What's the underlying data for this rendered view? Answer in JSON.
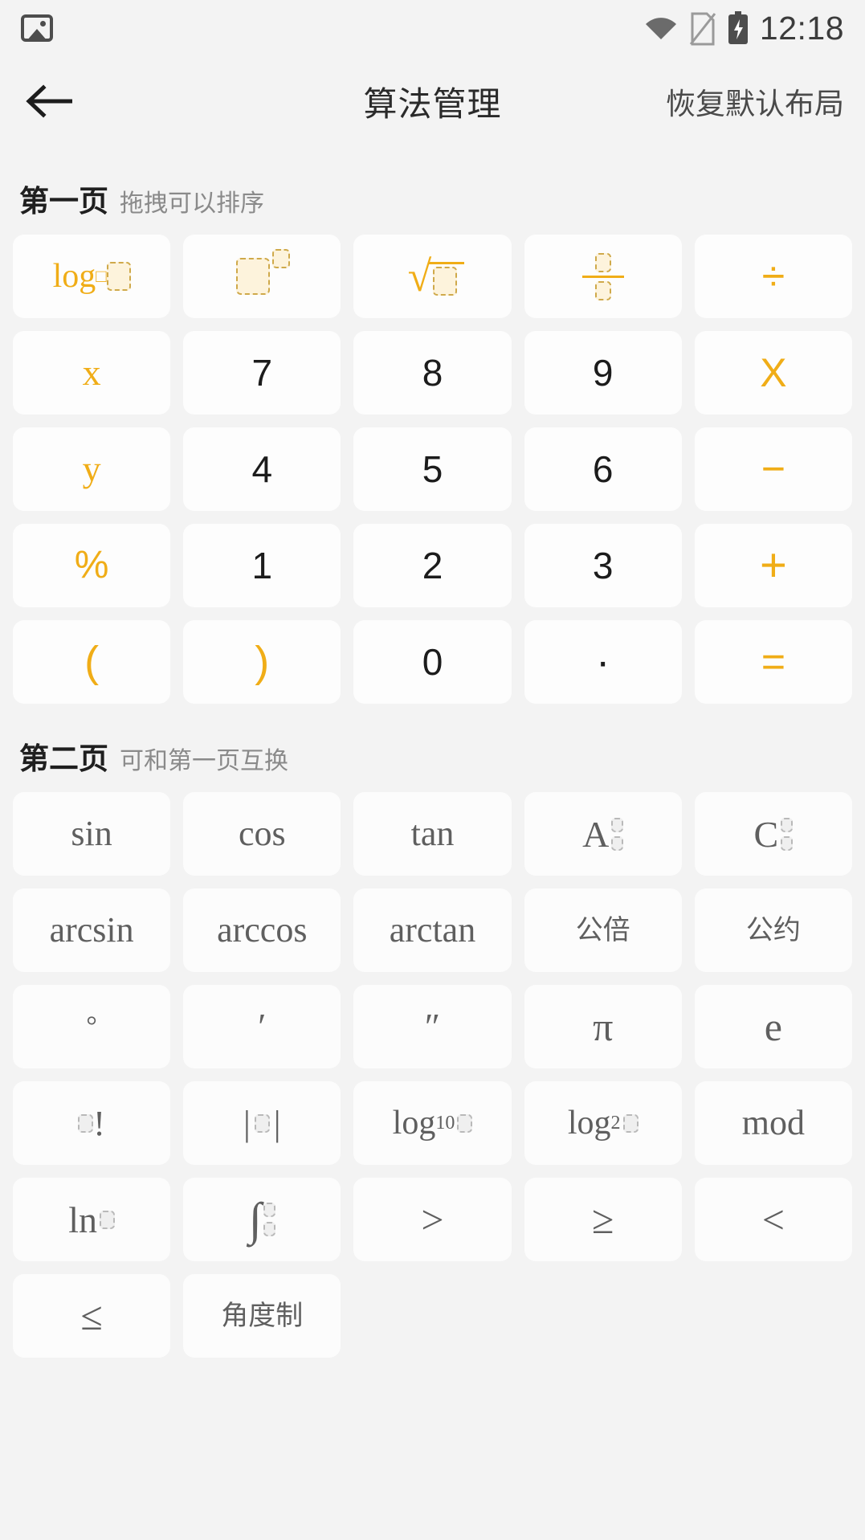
{
  "statusbar": {
    "time": "12:18",
    "icons": [
      "photo-icon",
      "wifi-icon",
      "sim-card-icon",
      "battery-charging-icon"
    ]
  },
  "appbar": {
    "back_icon": "arrow-left-icon",
    "title": "算法管理",
    "action_label": "恢复默认布局"
  },
  "sections": [
    {
      "title": "第一页",
      "subtitle": "拖拽可以排序",
      "keys": [
        {
          "label": "log₀□",
          "type": "glyph-logb",
          "style": "accent"
        },
        {
          "label": "□^□",
          "type": "glyph-power",
          "style": "accent"
        },
        {
          "label": "√□",
          "type": "glyph-sqrt",
          "style": "accent"
        },
        {
          "label": "□/□",
          "type": "glyph-fraction",
          "style": "accent"
        },
        {
          "label": "÷",
          "type": "text",
          "style": "accent"
        },
        {
          "label": "x",
          "type": "text",
          "style": "accent"
        },
        {
          "label": "7",
          "type": "text",
          "style": "num"
        },
        {
          "label": "8",
          "type": "text",
          "style": "num"
        },
        {
          "label": "9",
          "type": "text",
          "style": "num"
        },
        {
          "label": "X",
          "type": "text",
          "style": "accent"
        },
        {
          "label": "y",
          "type": "text",
          "style": "accent"
        },
        {
          "label": "4",
          "type": "text",
          "style": "num"
        },
        {
          "label": "5",
          "type": "text",
          "style": "num"
        },
        {
          "label": "6",
          "type": "text",
          "style": "num"
        },
        {
          "label": "−",
          "type": "text",
          "style": "accent"
        },
        {
          "label": "%",
          "type": "text",
          "style": "accent"
        },
        {
          "label": "1",
          "type": "text",
          "style": "num"
        },
        {
          "label": "2",
          "type": "text",
          "style": "num"
        },
        {
          "label": "3",
          "type": "text",
          "style": "num"
        },
        {
          "label": "+",
          "type": "text",
          "style": "accent"
        },
        {
          "label": "(",
          "type": "text",
          "style": "accent"
        },
        {
          "label": ")",
          "type": "text",
          "style": "accent"
        },
        {
          "label": "0",
          "type": "text",
          "style": "num"
        },
        {
          "label": "·",
          "type": "text",
          "style": "num"
        },
        {
          "label": "=",
          "type": "text",
          "style": "accent"
        }
      ]
    },
    {
      "title": "第二页",
      "subtitle": "可和第一页互换",
      "keys": [
        {
          "label": "sin",
          "type": "text"
        },
        {
          "label": "cos",
          "type": "text"
        },
        {
          "label": "tan",
          "type": "text"
        },
        {
          "label": "A",
          "type": "glyph-perm"
        },
        {
          "label": "C",
          "type": "glyph-comb"
        },
        {
          "label": "arcsin",
          "type": "text"
        },
        {
          "label": "arccos",
          "type": "text"
        },
        {
          "label": "arctan",
          "type": "text"
        },
        {
          "label": "公倍",
          "type": "cjk"
        },
        {
          "label": "公约",
          "type": "cjk"
        },
        {
          "label": "°",
          "type": "text"
        },
        {
          "label": "′",
          "type": "text"
        },
        {
          "label": "″",
          "type": "text"
        },
        {
          "label": "π",
          "type": "big"
        },
        {
          "label": "e",
          "type": "big"
        },
        {
          "label": "□!",
          "type": "glyph-factorial"
        },
        {
          "label": "|□|",
          "type": "glyph-abs"
        },
        {
          "label": "log₁₀□",
          "type": "glyph-log10"
        },
        {
          "label": "log₂□",
          "type": "glyph-log2"
        },
        {
          "label": "mod",
          "type": "text"
        },
        {
          "label": "ln□",
          "type": "glyph-ln"
        },
        {
          "label": "∫",
          "type": "glyph-integral"
        },
        {
          "label": ">",
          "type": "big"
        },
        {
          "label": "≥",
          "type": "big"
        },
        {
          "label": "<",
          "type": "big"
        },
        {
          "label": "≤",
          "type": "big"
        },
        {
          "label": "角度制",
          "type": "cjk"
        }
      ]
    }
  ],
  "colors": {
    "accent": "#f0ad17",
    "key_bg": "#fdfdfd",
    "page_bg": "#f3f3f3",
    "text_dark": "#1c1c1c",
    "text_gray": "#5f5f5f"
  }
}
